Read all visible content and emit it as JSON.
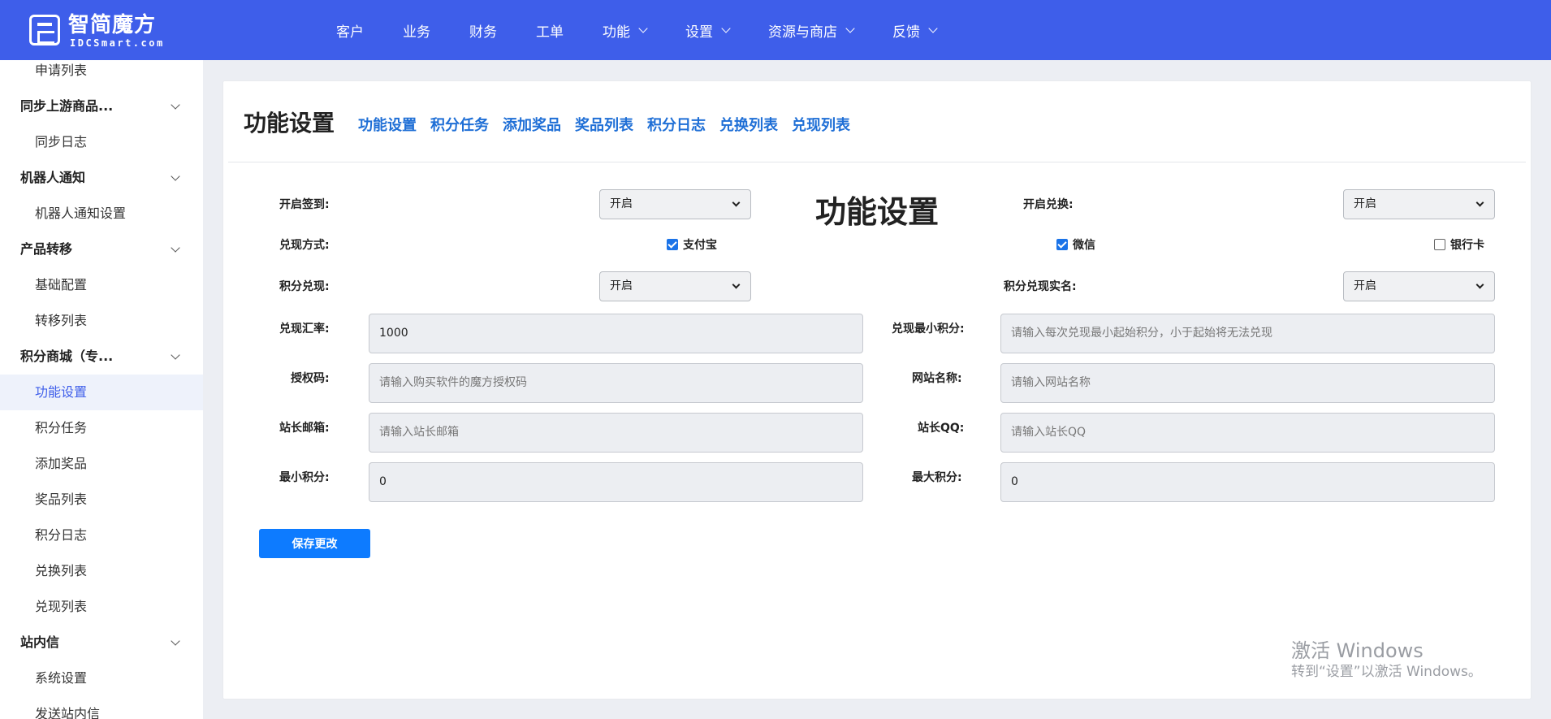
{
  "brand": {
    "title": "智简魔方",
    "subtitle": "IDCSmart.com"
  },
  "nav": [
    {
      "label": "客户",
      "has_dropdown": false
    },
    {
      "label": "业务",
      "has_dropdown": false
    },
    {
      "label": "财务",
      "has_dropdown": false
    },
    {
      "label": "工单",
      "has_dropdown": false
    },
    {
      "label": "功能",
      "has_dropdown": true
    },
    {
      "label": "设置",
      "has_dropdown": true
    },
    {
      "label": "资源与商店",
      "has_dropdown": true
    },
    {
      "label": "反馈",
      "has_dropdown": true
    }
  ],
  "sidebar": {
    "items": [
      {
        "label": "申请列表",
        "type": "sub"
      },
      {
        "label": "同步上游商品...",
        "type": "group"
      },
      {
        "label": "同步日志",
        "type": "sub"
      },
      {
        "label": "机器人通知",
        "type": "group"
      },
      {
        "label": "机器人通知设置",
        "type": "sub"
      },
      {
        "label": "产品转移",
        "type": "group"
      },
      {
        "label": "基础配置",
        "type": "sub"
      },
      {
        "label": "转移列表",
        "type": "sub"
      },
      {
        "label": "积分商城（专...",
        "type": "group"
      },
      {
        "label": "功能设置",
        "type": "sub",
        "active": true
      },
      {
        "label": "积分任务",
        "type": "sub"
      },
      {
        "label": "添加奖品",
        "type": "sub"
      },
      {
        "label": "奖品列表",
        "type": "sub"
      },
      {
        "label": "积分日志",
        "type": "sub"
      },
      {
        "label": "兑换列表",
        "type": "sub"
      },
      {
        "label": "兑现列表",
        "type": "sub"
      },
      {
        "label": "站内信",
        "type": "group"
      },
      {
        "label": "系统设置",
        "type": "sub"
      },
      {
        "label": "发送站内信",
        "type": "sub"
      }
    ]
  },
  "page": {
    "title": "功能设置",
    "tabs": [
      "功能设置",
      "积分任务",
      "添加奖品",
      "奖品列表",
      "积分日志",
      "兑换列表",
      "兑现列表"
    ],
    "form_heading": "功能设置"
  },
  "form": {
    "signin": {
      "label": "开启签到:",
      "value": "开启"
    },
    "exchange": {
      "label": "开启兑换:",
      "value": "开启"
    },
    "cashout_method": {
      "label": "兑现方式:",
      "options": [
        {
          "label": "支付宝",
          "checked": true
        },
        {
          "label": "微信",
          "checked": true
        },
        {
          "label": "银行卡",
          "checked": false
        }
      ]
    },
    "points_cashout": {
      "label": "积分兑现:",
      "value": "开启"
    },
    "cashout_realname": {
      "label": "积分兑现实名:",
      "value": "开启"
    },
    "rate": {
      "label": "兑现汇率:",
      "value": "1000",
      "placeholder": ""
    },
    "min_cashout": {
      "label": "兑现最小积分:",
      "value": "",
      "placeholder": "请输入每次兑现最小起始积分，小于起始将无法兑现"
    },
    "auth_code": {
      "label": "授权码:",
      "value": "",
      "placeholder": "请输入购买软件的魔方授权码"
    },
    "site_name": {
      "label": "网站名称:",
      "value": "",
      "placeholder": "请输入网站名称"
    },
    "admin_email": {
      "label": "站长邮箱:",
      "value": "",
      "placeholder": "请输入站长邮箱"
    },
    "admin_qq": {
      "label": "站长QQ:",
      "value": "",
      "placeholder": "请输入站长QQ"
    },
    "min_points": {
      "label": "最小积分:",
      "value": "0",
      "placeholder": ""
    },
    "max_points": {
      "label": "最大积分:",
      "value": "0",
      "placeholder": ""
    },
    "save_label": "保存更改"
  },
  "watermark": {
    "line1": "激活 Windows",
    "line2": "转到“设置”以激活 Windows。"
  },
  "colors": {
    "header": "#3e5eea",
    "link": "#1f6fd6",
    "primary_button": "#0d7bff",
    "active_bg": "#eef2fb"
  }
}
